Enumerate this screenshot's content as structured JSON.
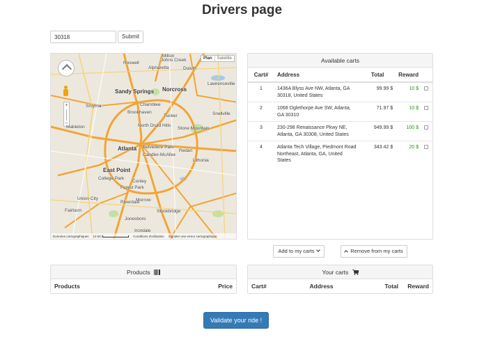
{
  "page_title": "Drivers page",
  "search": {
    "value": "30318",
    "submit_label": "Submit"
  },
  "map": {
    "type_buttons": [
      "Plan",
      "Satellite"
    ],
    "labels": [
      "Roswell",
      "Johns Creek",
      "Milton",
      "Alpharetta",
      "Duluth",
      "Sandy Springs",
      "Norcross",
      "Lawrenceville",
      "Smyrna",
      "Chamblee",
      "Mableton",
      "Brookhaven",
      "Tucker",
      "Snellville",
      "North Druid Hills",
      "Stone Mountain",
      "Atlanta",
      "Belvedere Park",
      "Candler-McAfee",
      "Redan",
      "Lithonia",
      "East Point",
      "College Park",
      "Forest Park",
      "Conley",
      "Union City",
      "Riverdale",
      "Morrow",
      "Fairburn",
      "Jonesboro",
      "Stockbridge",
      "Irondale"
    ],
    "footer": [
      "Données cartographiques",
      "10 km",
      "Conditions d'utilisation",
      "Signaler une erreur cartographique"
    ],
    "road_color": "#f3a433",
    "water_color": "#a9c9e6",
    "park_color": "#c4dfa9"
  },
  "carts": {
    "heading": "Available carts",
    "columns": [
      "Cart#",
      "Address",
      "Total",
      "Reward"
    ],
    "rows": [
      {
        "num": "1",
        "address": "1436A Blyss Ave NW, Atlanta, GA 30318, United States",
        "total": "99.99 $",
        "reward": "10 $"
      },
      {
        "num": "2",
        "address": "1068 Oglethorpe Ave SW, Atlanta, GA 30310",
        "total": "71.97 $",
        "reward": "10 $"
      },
      {
        "num": "3",
        "address": "230-298 Renaissance Pkwy NE, Atlanta, GA 30308, United States",
        "total": "949.99 $",
        "reward": "100 $"
      },
      {
        "num": "4",
        "address": "Atlanta Tech Village, Piedmont Road Northeast, Atlanta, GA, United States",
        "total": "343.42 $",
        "reward": "20 $"
      }
    ]
  },
  "actions": {
    "add_label": "Add to my carts",
    "remove_label": "Remove from my carts"
  },
  "products": {
    "heading": "Products",
    "columns": [
      "Products",
      "Price"
    ]
  },
  "your_carts": {
    "heading": "Your carts",
    "columns": [
      "Cart#",
      "Address",
      "Total",
      "Reward"
    ]
  },
  "validate_label": "Validate your ride !",
  "colors": {
    "primary": "#337ab7",
    "reward_green": "#2e8b17"
  }
}
